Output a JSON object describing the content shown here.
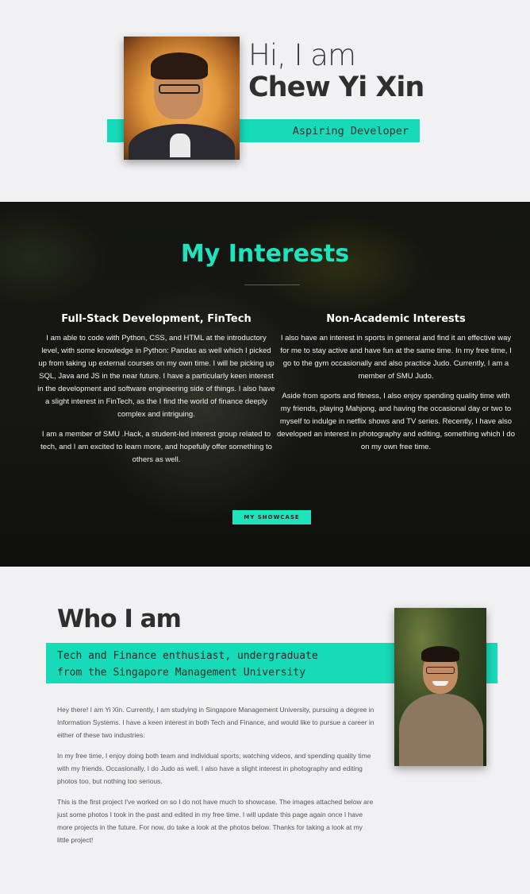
{
  "hero": {
    "greeting": "Hi, I am",
    "name": "Chew Yi Xin",
    "tagline": "Aspiring Developer"
  },
  "interests": {
    "title": "My Interests",
    "columns": [
      {
        "heading": "Full-Stack Development, FinTech",
        "paragraphs": [
          "I am able to code with Python, CSS, and HTML at the introductory level, with some knowledge in Python: Pandas as well which I picked up from taking up external courses on my own time. I will be picking up SQL, Java and JS in the near future. I have a particularly keen interest in the development and software engineering side of things. I also have a slight interest in FinTech, as the I find the world of finance deeply complex and intriguing.",
          "I am a member of SMU .Hack, a student-led interest group related to tech, and I am excited to learn more, and hopefully offer something to others as well."
        ]
      },
      {
        "heading": "Non-Academic Interests",
        "paragraphs": [
          "I also have an interest in sports in general and find it an effective way for me to stay active and have fun at the same time. In my free time, I go to the gym occasionally and also practice Judo. Currently, I am a member of SMU Judo.",
          "Aside from sports and fitness, I also enjoy spending quality time with my friends, playing Mahjong, and having the occasional day or two to myself to indulge in netflix shows and TV series. Recently, I have also developed an interest in photography and editing, something which I do on my own free time."
        ]
      }
    ],
    "button_label": "MY SHOWCASE"
  },
  "about": {
    "title": "Who I am",
    "tagline": "Tech and Finance enthusiast, undergraduate\nfrom the Singapore Management University",
    "paragraphs": [
      "Hey there! I am Yi Xin. Currently, I am studying in Singapore Management University, pursuing a degree in Information Systems. I have a keen interest in both Tech and Finance, and would like to pursue a career in either of these two industries.",
      "In my free time, I enjoy doing both team and individual sports, watching videos, and spending quality time with my friends. Occasionally, I do Judo as well. I also have a slight interest in photography and editing photos too, but nothing too serious.",
      "This is the first project I've worked on so I do not have much to showcase. The images attached below are just some photos I took in the past and edited in my free time. I will update this page again once I have more projects in the future. For now, do take a look at the photos below. Thanks for taking a look at my little project!"
    ]
  },
  "colors": {
    "accent": "#1ee4bd",
    "dark_section": "#151612",
    "page_bg": "#efeff1"
  }
}
